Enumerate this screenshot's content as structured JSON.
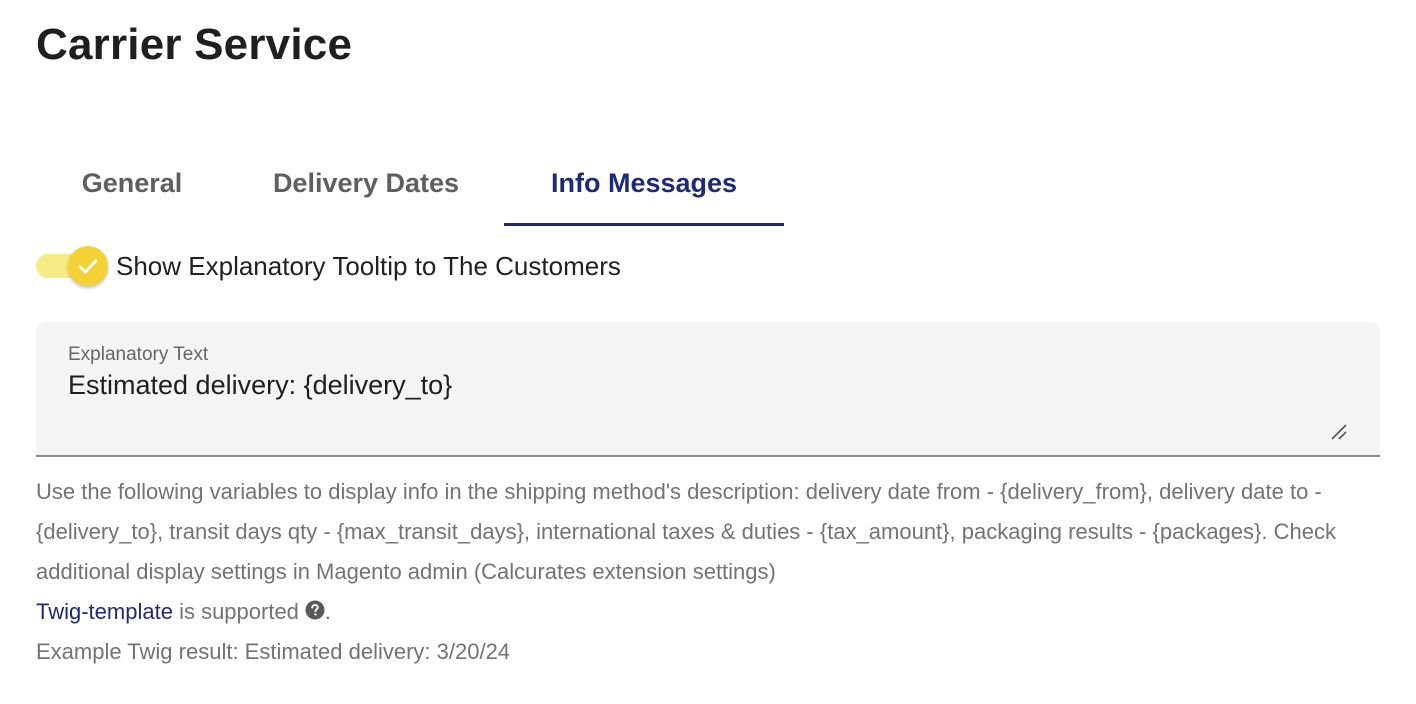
{
  "page": {
    "title": "Carrier Service"
  },
  "tabs": [
    {
      "label": "General"
    },
    {
      "label": "Delivery Dates"
    },
    {
      "label": "Info Messages",
      "active": true
    }
  ],
  "toggle": {
    "label": "Show Explanatory Tooltip to The Customers",
    "checked": true,
    "track_color": "#f6eb85",
    "thumb_color": "#f4d233",
    "icon": "check-icon"
  },
  "field": {
    "label": "Explanatory Text",
    "value": "Estimated delivery: {delivery_to}",
    "resize_icon": "resize-handle-icon"
  },
  "helper": {
    "variables_text": "Use the following variables to display info in the shipping method's description: delivery date from - {delivery_from}, delivery date to - {delivery_to}, transit days qty - {max_transit_days}, international taxes & duties - {tax_amount}, packaging results - {packages}. Check additional display settings in Magento admin (Calcurates extension settings)",
    "twig_link": "Twig-template",
    "twig_suffix": " is supported",
    "twig_period": ".",
    "help_icon": "question-circle-icon",
    "example": "Example Twig result: Estimated delivery: 3/20/24"
  },
  "colors": {
    "accent": "#1e2a78",
    "muted_text": "#737373",
    "field_bg": "#f4f4f4"
  }
}
